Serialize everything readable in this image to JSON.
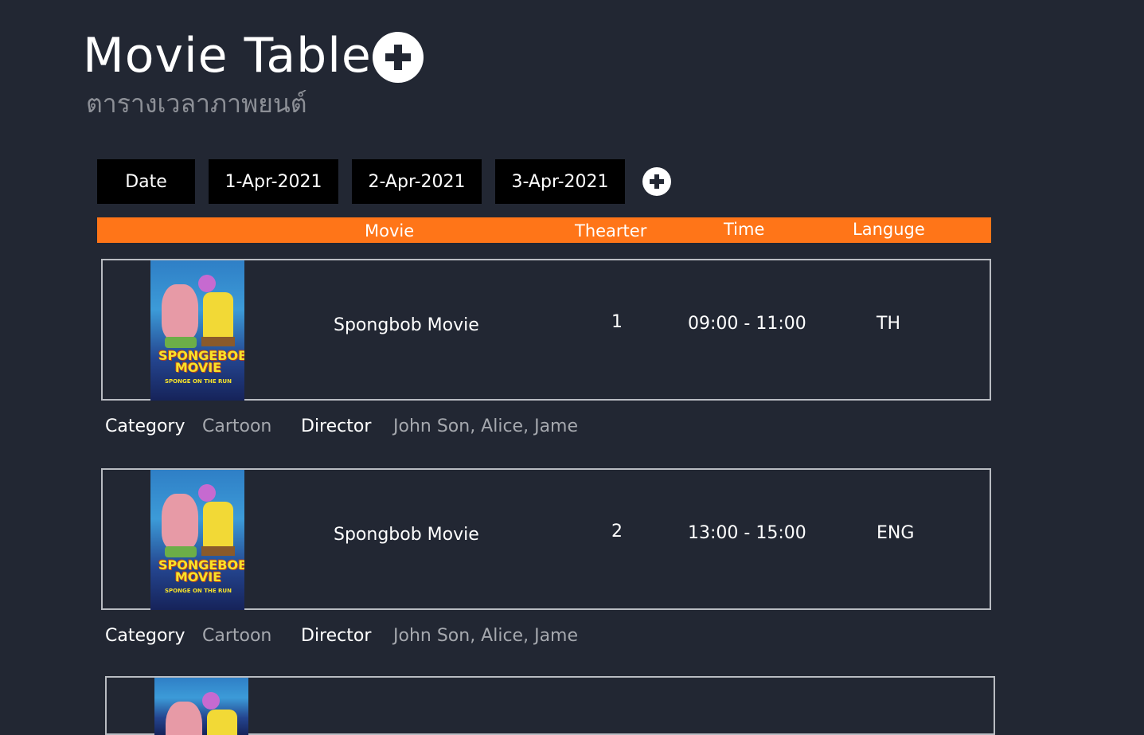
{
  "page": {
    "title": "Movie Table",
    "subtitle": "ตารางเวลาภาพยนต์"
  },
  "date_tabs": {
    "label": "Date",
    "dates": [
      "1-Apr-2021",
      "2-Apr-2021",
      "3-Apr-2021"
    ]
  },
  "table_header": {
    "movie": "Movie",
    "theater": "Thearter",
    "time": "Time",
    "language": "Languge"
  },
  "movies": [
    {
      "name": "Spongbob Movie",
      "theater": "1",
      "time": "09:00 - 11:00",
      "language": "TH",
      "category_label": "Category",
      "category": "Cartoon",
      "director_label": "Director",
      "director": "John Son, Alice, Jame"
    },
    {
      "name": "Spongbob Movie",
      "theater": "2",
      "time": "13:00 - 15:00",
      "language": "ENG",
      "category_label": "Category",
      "category": "Cartoon",
      "director_label": "Director",
      "director": "John Son, Alice, Jame"
    }
  ],
  "poster": {
    "title_line1": "SPONGEBOB",
    "title_line2": "MOVIE",
    "tagline": "SPONGE ON THE RUN"
  },
  "colors": {
    "background": "#222733",
    "header_bar": "#ff7518",
    "date_button": "#000000",
    "muted_text": "#a5a8ae"
  },
  "icons": {
    "title_add": "plus-circle-icon",
    "date_add": "plus-circle-icon"
  }
}
